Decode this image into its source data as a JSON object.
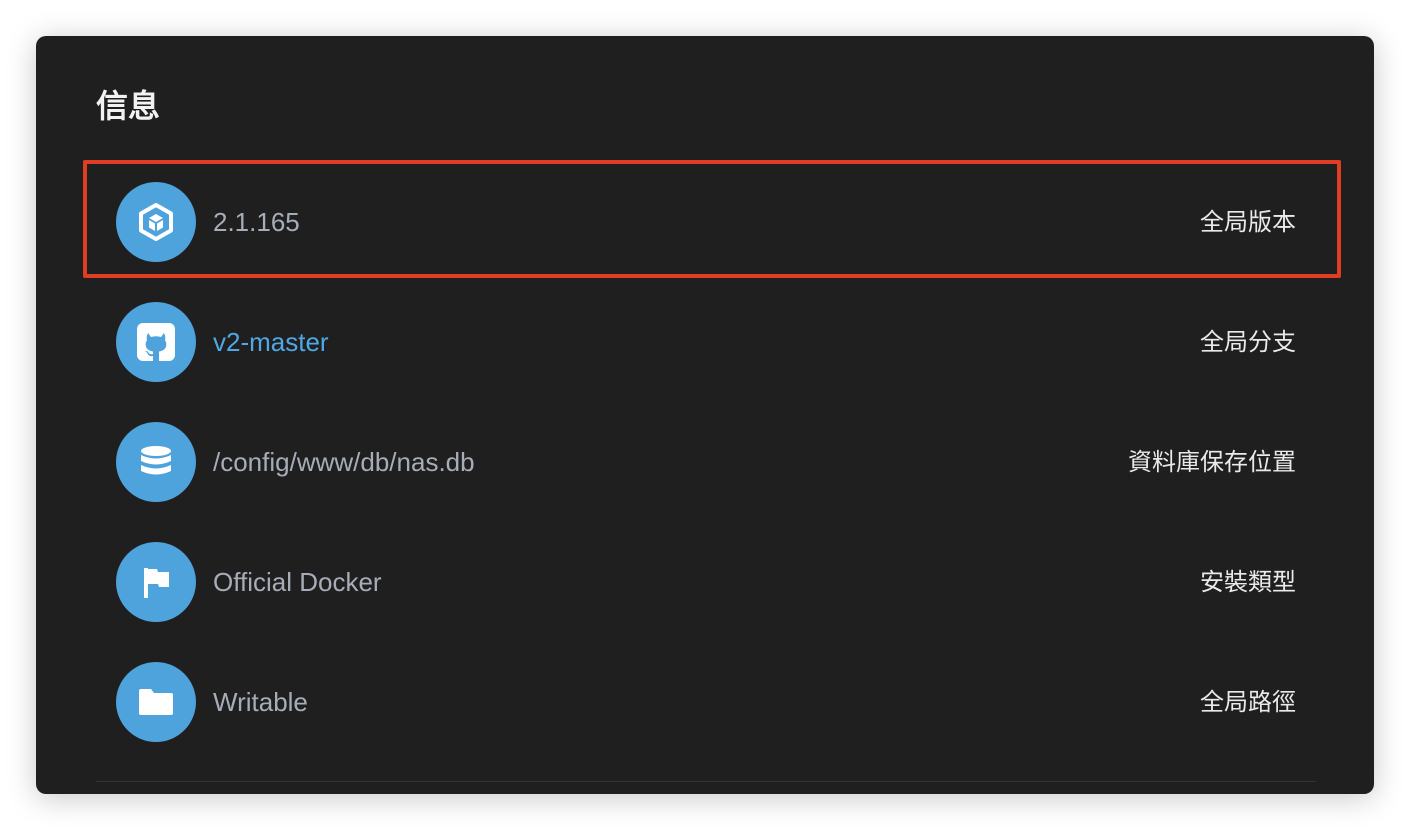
{
  "panel": {
    "title": "信息"
  },
  "rows": [
    {
      "icon": "cube-icon",
      "value": "2.1.165",
      "label": "全局版本",
      "is_link": false
    },
    {
      "icon": "github-icon",
      "value": "v2-master",
      "label": "全局分支",
      "is_link": true
    },
    {
      "icon": "database-icon",
      "value": "/config/www/db/nas.db",
      "label": "資料庫保存位置",
      "is_link": false
    },
    {
      "icon": "flag-icon",
      "value": "Official Docker",
      "label": "安裝類型",
      "is_link": false
    },
    {
      "icon": "folder-icon",
      "value": "Writable",
      "label": "全局路徑",
      "is_link": false
    }
  ],
  "colors": {
    "panel_background": "#1f1f1f",
    "icon_circle": "#4fa3dc",
    "link_text": "#4fa8e4",
    "value_text": "#a7adb8",
    "label_text": "#eaeaea",
    "highlight_border": "#e03e24"
  }
}
